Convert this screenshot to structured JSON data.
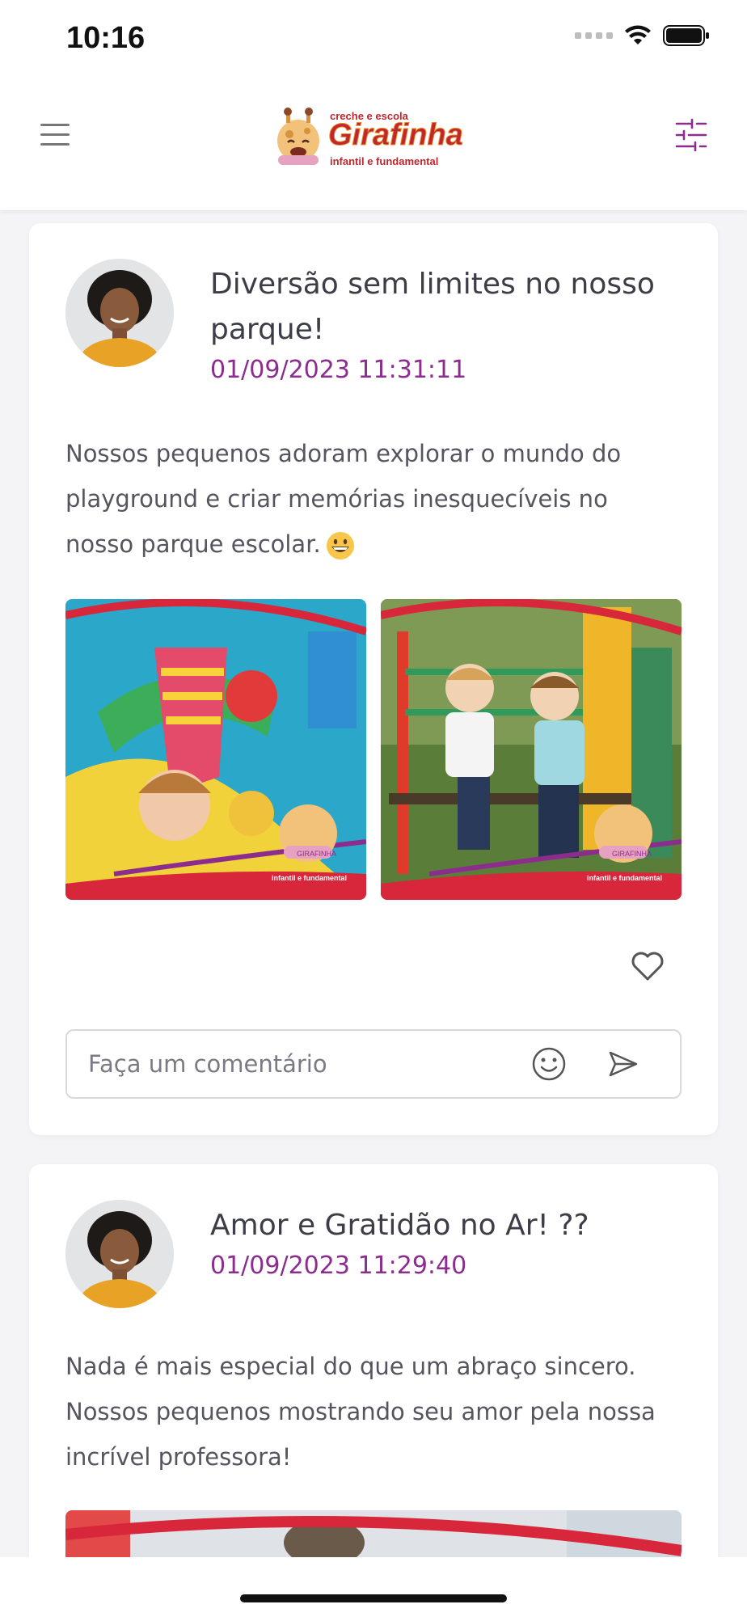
{
  "status_bar": {
    "time": "10:16"
  },
  "header": {
    "logo_top": "creche e escola",
    "logo_name": "Girafinha",
    "logo_sub": "infantil e fundamental"
  },
  "posts": [
    {
      "title": "Diversão sem limites no nosso parque!",
      "date": "01/09/2023 11:31:11",
      "text": "Nossos pequenos adoram explorar o mundo do playground e criar memórias inesquecíveis no nosso parque escolar."
    },
    {
      "title": "Amor e Gratidão no Ar! ??",
      "date": "01/09/2023 11:29:40",
      "text": "Nada é mais especial do que um abraço sincero. Nossos pequenos mostrando seu amor pela nossa incrível professora!"
    }
  ],
  "comment": {
    "placeholder": "Faça um comentário"
  },
  "photo_watermark": {
    "name": "GIRAFINHA",
    "sub": "infantil e fundamental"
  },
  "colors": {
    "accent": "#8c2c8f",
    "logo_red": "#c0262d",
    "logo_orange": "#e98a2a"
  },
  "icons": [
    "hamburger-menu-icon",
    "filter-sliders-icon",
    "heart-icon",
    "smiley-icon",
    "send-icon"
  ]
}
